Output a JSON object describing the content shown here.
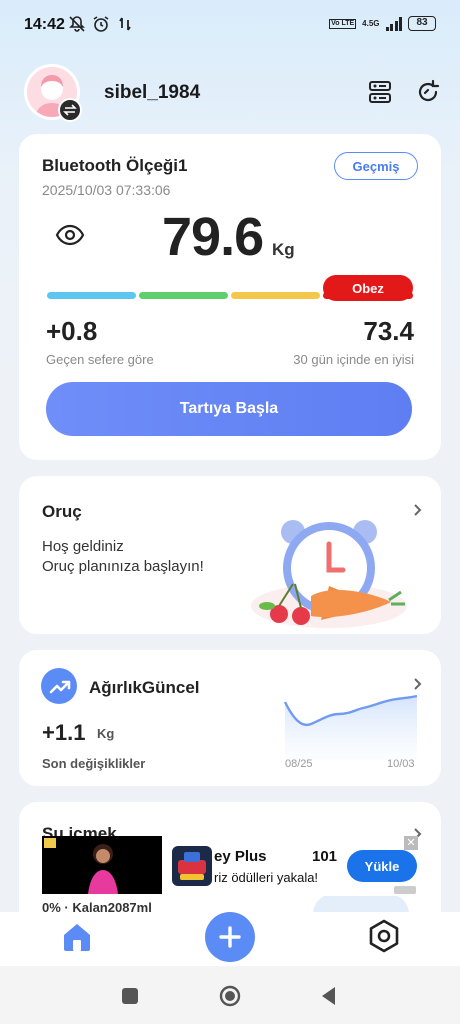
{
  "status_bar": {
    "time": "14:42",
    "network_lte": "Vo LTE",
    "network_4g": "4.5G",
    "battery": "83"
  },
  "header": {
    "username": "sibel_1984"
  },
  "scale_card": {
    "title": "Bluetooth Ölçeği1",
    "date": "2025/10/03 07:33:06",
    "history_label": "Geçmiş",
    "weight_value": "79.6",
    "weight_unit": "Kg",
    "bmi_status": "Obez",
    "bmi_colors": [
      "#5bc6f0",
      "#5fcf6b",
      "#f3c84a",
      "#e31818"
    ],
    "change_value": "+0.8",
    "change_label": "Geçen sefere göre",
    "best_value": "73.4",
    "best_label": "30 gün içinde en iyisi",
    "start_button": "Tartıya Başla"
  },
  "fasting_card": {
    "title": "Oruç",
    "line1": "Hoş geldiniz",
    "line2": "Oruç planınıza başlayın!"
  },
  "weight_card": {
    "title": "AğırlıkGüncel",
    "change_value": "+1.1",
    "unit": "Kg",
    "label": "Son değişiklikler",
    "date_start": "08/25",
    "date_end": "10/03"
  },
  "water_card": {
    "title": "Su içmek",
    "progress": "0% · Kalan2087ml"
  },
  "ad": {
    "app_name": "ey Plus",
    "rating": "101",
    "subtitle": "riz ödülleri yakala!",
    "install_label": "Yükle",
    "close_label": "✕"
  },
  "colors": {
    "accent": "#5b8cf6",
    "danger": "#e31818"
  },
  "icons": {
    "header_left": "scale-device-icon",
    "header_right": "sync-icon",
    "nav": [
      "home-icon",
      "add-icon",
      "settings-icon"
    ]
  }
}
